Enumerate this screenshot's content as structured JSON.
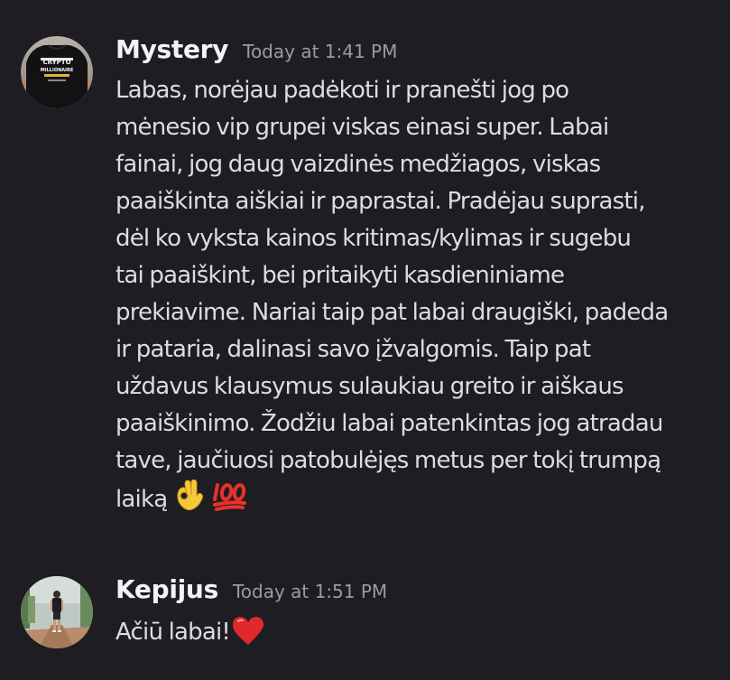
{
  "messages": [
    {
      "username": "Mystery",
      "timestamp": "Today at 1:41 PM",
      "text": "Labas, norėjau padėkoti ir pranešti jog po\nmėnesio vip grupei viskas einasi super. Labai\nfainai, jog daug vaizdinės medžiagos, viskas\npaaiškinta aiškiai ir paprastai. Pradėjau suprasti,\ndėl ko vyksta kainos kritimas/kylimas ir sugebu\ntai paaiškint, bei pritaikyti kasdieniniame\nprekiavime. Nariai taip pat labai draugiški, padeda\nir pataria, dalinasi savo įžvalgomis. Taip pat\nuždavus klausymus sulaukiau greito ir aiškaus\npaaiškinimo. Žodžiu labai patenkintas jog atradau\ntave, jaučiuosi patobulėjęs metus per tokį trumpą\nlaiką",
      "emojis": [
        "ok-hand-emoji",
        "hundred-points-emoji"
      ],
      "avatar_text": "CRYPTO MILLIONAIRE"
    },
    {
      "username": "Kepijus",
      "timestamp": "Today at 1:51 PM",
      "text": "Ačiū labai!",
      "emojis": [
        "red-heart-emoji"
      ]
    }
  ],
  "colors": {
    "background": "#1d1d22",
    "username": "#f2f3f5",
    "timestamp": "#9a9ca4",
    "text": "#dcdde1"
  }
}
